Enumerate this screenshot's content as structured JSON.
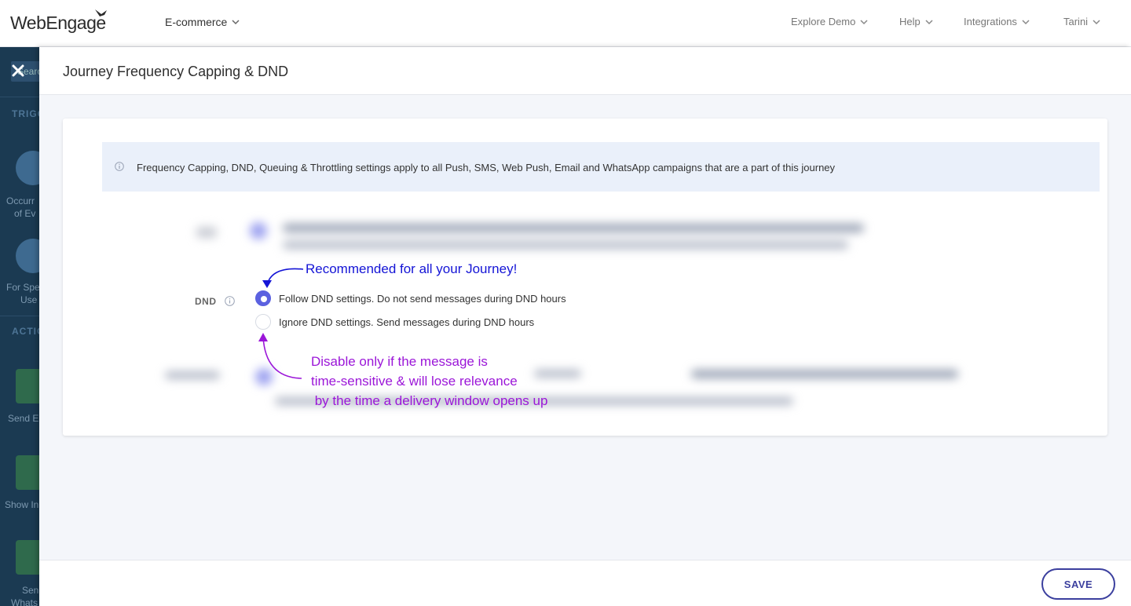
{
  "app": {
    "logo_text": "WebEngage",
    "workspace": "E-commerce"
  },
  "topnav": {
    "items": [
      {
        "label": "Explore Demo"
      },
      {
        "label": "Help"
      },
      {
        "label": "Integrations"
      },
      {
        "label": "Tarini"
      }
    ]
  },
  "sidebar": {
    "search_placeholder": "Search",
    "sections": [
      {
        "header": "TRIGG"
      },
      {
        "header": "ACTIO"
      }
    ],
    "items": [
      {
        "label_line1": "Occurr",
        "label_line2": "of Ev"
      },
      {
        "label_line1": "For Spe",
        "label_line2": "Use"
      },
      {
        "label_line1": "Send E"
      },
      {
        "label_line1": "Show In"
      },
      {
        "label_line1": "Sen",
        "label_line2": "Whats"
      }
    ]
  },
  "panel": {
    "title": "Journey Frequency Capping & DND",
    "info_text": "Frequency Capping, DND, Queuing & Throttling settings apply to all Push, SMS, Web Push, Email and WhatsApp campaigns that are a part of this journey",
    "dnd": {
      "label": "DND",
      "options": [
        {
          "label": "Follow DND settings. Do not send messages during DND hours",
          "selected": true
        },
        {
          "label": "Ignore DND settings. Send messages during DND hours",
          "selected": false
        }
      ]
    },
    "annotations": {
      "recommended": "Recommended for all your Journey!",
      "disable_line1": "Disable only if the message is",
      "disable_line2": "time-sensitive & will lose relevance",
      "disable_line3": " by the time a delivery window opens up"
    },
    "save_label": "SAVE"
  },
  "colors": {
    "accent": "#5b61e0",
    "save_border": "#3b3f9e",
    "annotation_blue": "#1414d6",
    "annotation_purple": "#9b16d8",
    "sidebar_bg": "#1b3a52"
  }
}
